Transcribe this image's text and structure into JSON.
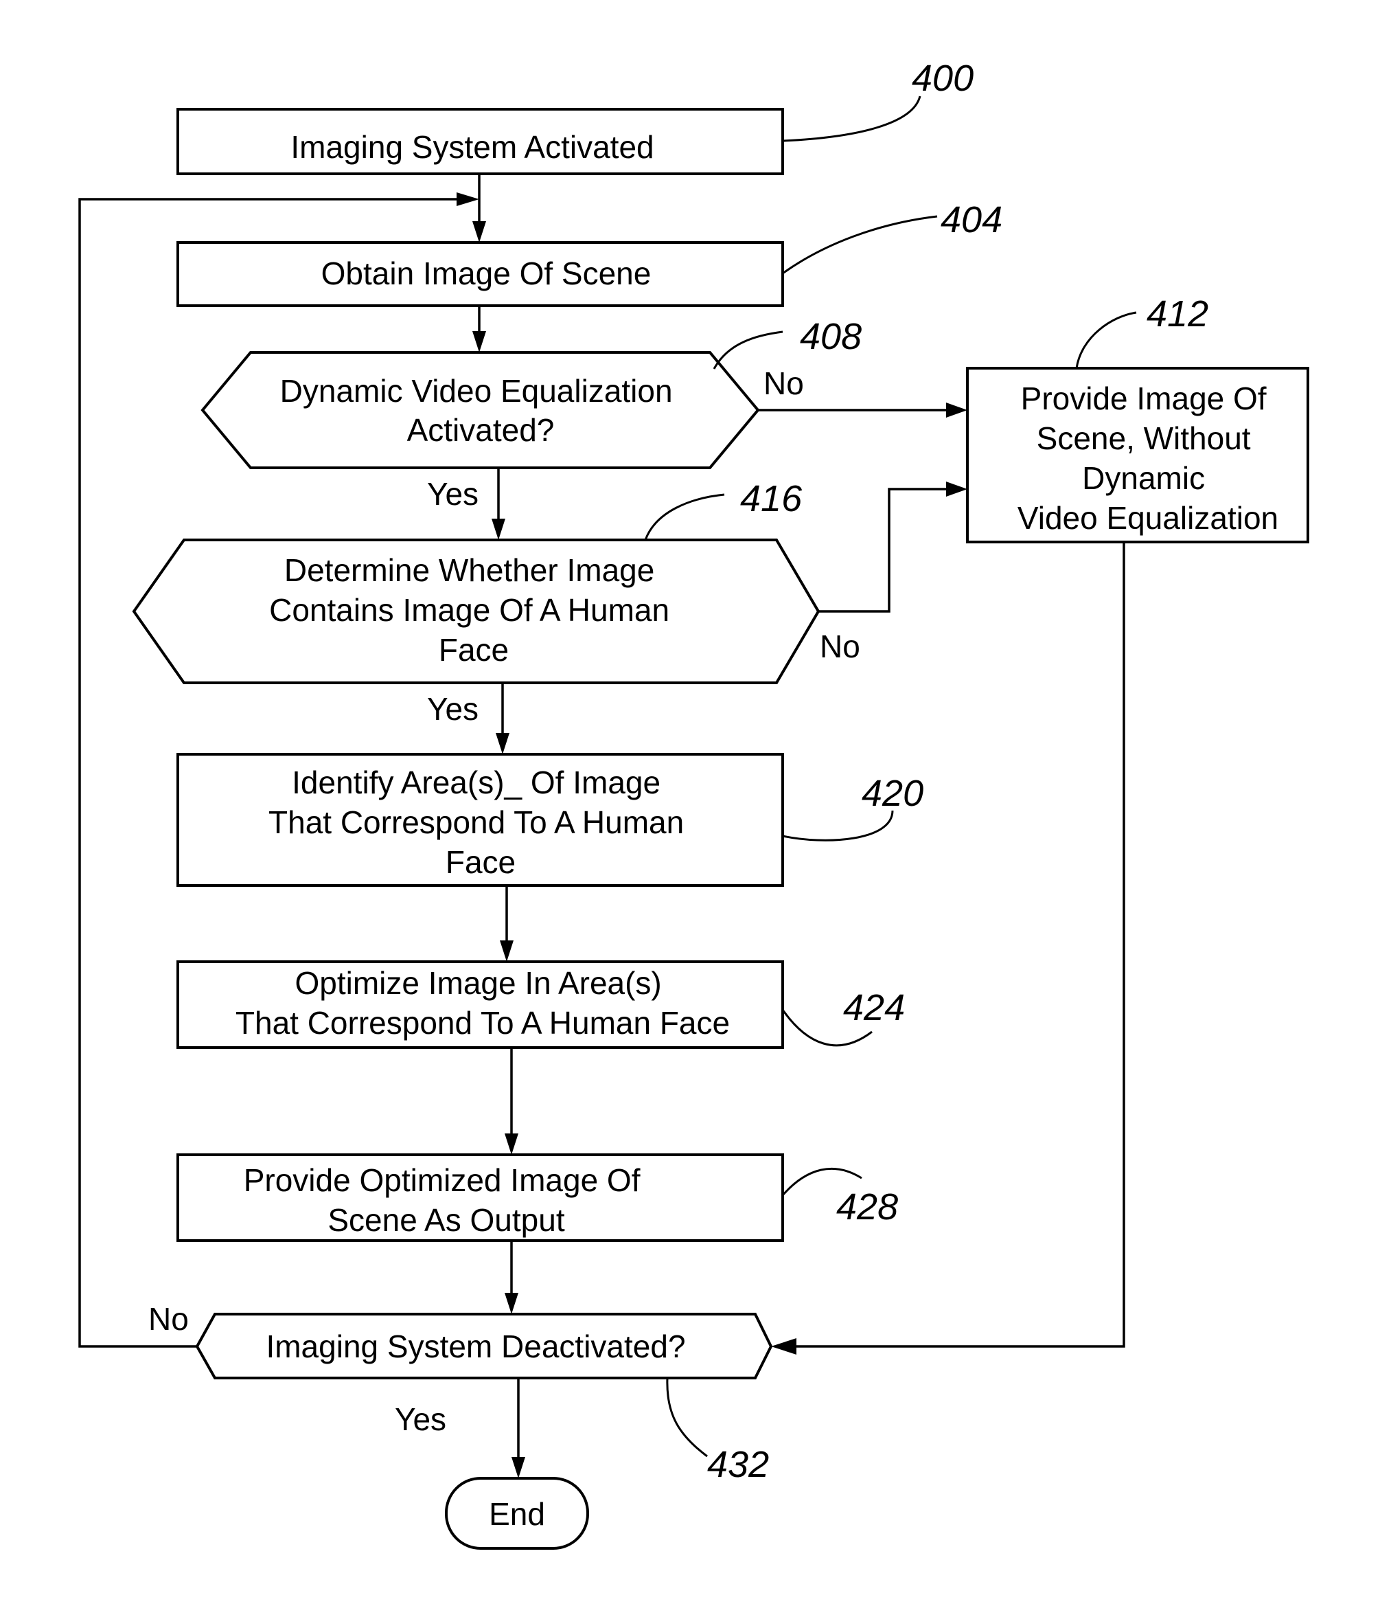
{
  "figure": {
    "steps": {
      "s400": {
        "ref": "400",
        "lines": [
          "Imaging System Activated"
        ]
      },
      "s404": {
        "ref": "404",
        "lines": [
          "Obtain Image Of Scene"
        ]
      },
      "s408": {
        "ref": "408",
        "lines": [
          "Dynamic Video Equalization",
          "Activated?"
        ]
      },
      "s412": {
        "ref": "412",
        "lines": [
          "Provide Image Of",
          "Scene, Without",
          "Dynamic",
          "Video Equalization"
        ]
      },
      "s416": {
        "ref": "416",
        "lines": [
          "Determine Whether Image",
          "Contains Image Of A Human",
          "Face"
        ]
      },
      "s420": {
        "ref": "420",
        "lines": [
          "Identify Area(s)_ Of Image",
          "That Correspond To A Human",
          "Face"
        ]
      },
      "s424": {
        "ref": "424",
        "lines": [
          "Optimize Image In Area(s)",
          "That Correspond To A Human Face"
        ]
      },
      "s428": {
        "ref": "428",
        "lines": [
          "Provide Optimized Image Of",
          "Scene As Output"
        ]
      },
      "s432": {
        "ref": "432",
        "lines": [
          "Imaging System Deactivated?"
        ]
      },
      "end": {
        "lines": [
          "End"
        ]
      }
    },
    "edge_labels": {
      "e408_no": "No",
      "e408_yes": "Yes",
      "e416_no": "No",
      "e416_yes": "Yes",
      "e432_no": "No",
      "e432_yes": "Yes"
    }
  }
}
